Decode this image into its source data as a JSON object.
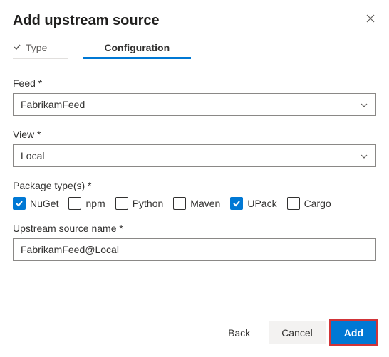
{
  "header": {
    "title": "Add upstream source"
  },
  "tabs": {
    "type_label": "Type",
    "config_label": "Configuration"
  },
  "feed": {
    "label": "Feed *",
    "value": "FabrikamFeed"
  },
  "view": {
    "label": "View *",
    "value": "Local"
  },
  "package_types": {
    "label": "Package type(s) *",
    "items": [
      {
        "label": "NuGet",
        "checked": true
      },
      {
        "label": "npm",
        "checked": false
      },
      {
        "label": "Python",
        "checked": false
      },
      {
        "label": "Maven",
        "checked": false
      },
      {
        "label": "UPack",
        "checked": true
      },
      {
        "label": "Cargo",
        "checked": false
      }
    ]
  },
  "upstream_name": {
    "label": "Upstream source name *",
    "value": "FabrikamFeed@Local"
  },
  "footer": {
    "back": "Back",
    "cancel": "Cancel",
    "add": "Add"
  }
}
